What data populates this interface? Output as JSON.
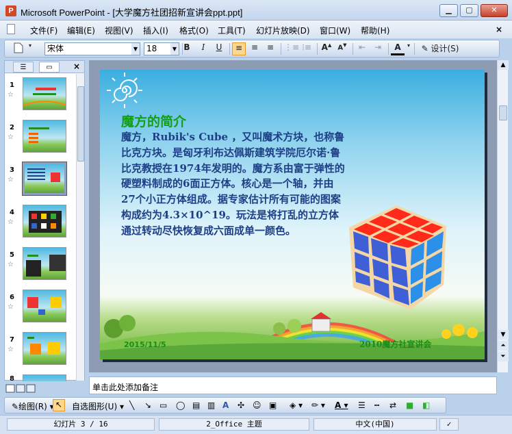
{
  "window": {
    "title": "Microsoft PowerPoint - [大学魔方社团招新宣讲会ppt.ppt]",
    "minimize": "▁",
    "maximize": "▢",
    "close": "✕"
  },
  "menu": {
    "items": [
      "文件(F)",
      "编辑(E)",
      "视图(V)",
      "插入(I)",
      "格式(O)",
      "工具(T)",
      "幻灯片放映(D)",
      "窗口(W)",
      "帮助(H)"
    ],
    "close": "×"
  },
  "toolbar": {
    "font_name": "宋体",
    "font_size": "18",
    "bold": "B",
    "italic": "I",
    "underline": "U",
    "design_label": "设计(S)"
  },
  "left_pane": {
    "slides": [
      {
        "num": "1"
      },
      {
        "num": "2"
      },
      {
        "num": "3"
      },
      {
        "num": "4"
      },
      {
        "num": "5"
      },
      {
        "num": "6"
      },
      {
        "num": "7"
      },
      {
        "num": "8"
      }
    ],
    "selected_index": 2
  },
  "slide": {
    "title": "魔方的简介",
    "body": "魔方，Rubik's Cube ，又叫魔术方块，也称鲁比克方块。是匈牙利布达佩斯建筑学院厄尔诺·鲁比克教授在1974年发明的。魔方系由富于弹性的硬塑料制成的6面正方体。核心是一个轴，并由27个小正方体组成。据专家估计所有可能的图案构成约为4.3×10^19。玩法是将打乱的立方体通过转动尽快恢复成六面成单一颜色。",
    "date": "2015/11/5",
    "footer": "2010魔方社宣讲会"
  },
  "notes": {
    "placeholder": "单击此处添加备注"
  },
  "drawing_toolbar": {
    "draw_label": "绘图(R)",
    "autoshapes_label": "自选图形(U)"
  },
  "status": {
    "slide_info": "幻灯片 3 / 16",
    "theme": "2_Office 主题",
    "language": "中文(中国)"
  },
  "colors": {
    "slide_title": "#139f13",
    "slide_body": "#1e3f86",
    "window_frame": "#b9d1ea"
  }
}
